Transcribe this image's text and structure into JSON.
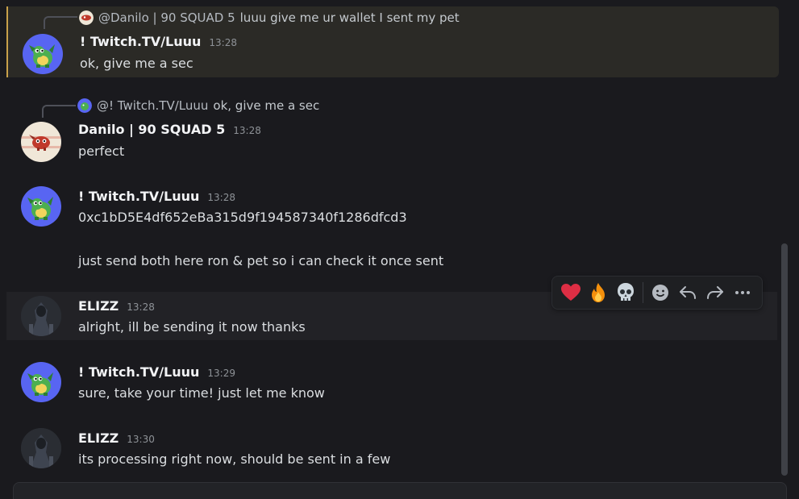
{
  "colors": {
    "accent": "#5865f2",
    "highlight_border": "#c8a14a"
  },
  "messages": [
    {
      "author": "! Twitch.TV/Luuu",
      "time": "13:28",
      "text": "ok, give me a sec",
      "reply": {
        "name": "@Danilo | 90  SQUAD 5",
        "text": "luuu give me ur wallet I sent my pet"
      }
    },
    {
      "author": "Danilo | 90  SQUAD 5",
      "time": "13:28",
      "text": "perfect",
      "reply": {
        "name": "@! Twitch.TV/Luuu",
        "text": "ok, give me a sec"
      }
    },
    {
      "author": "! Twitch.TV/Luuu",
      "time": "13:28",
      "lines": [
        "0xc1bD5E4df652eBa315d9f194587340f1286dfcd3",
        "just send both here ron & pet so i can check it once sent"
      ]
    },
    {
      "author": "ELIZZ",
      "time": "13:28",
      "text": "alright, ill be sending it now thanks"
    },
    {
      "author": "! Twitch.TV/Luuu",
      "time": "13:29",
      "text": "sure, take your time! just let me know"
    },
    {
      "author": "ELIZZ",
      "time": "13:30",
      "text": "its processing right now, should be sent in a few"
    }
  ],
  "toolbar": {
    "reactions": [
      "heart",
      "fire",
      "skull"
    ],
    "actions": [
      "add-reaction-icon",
      "reply-icon",
      "forward-icon",
      "more-icon"
    ]
  }
}
